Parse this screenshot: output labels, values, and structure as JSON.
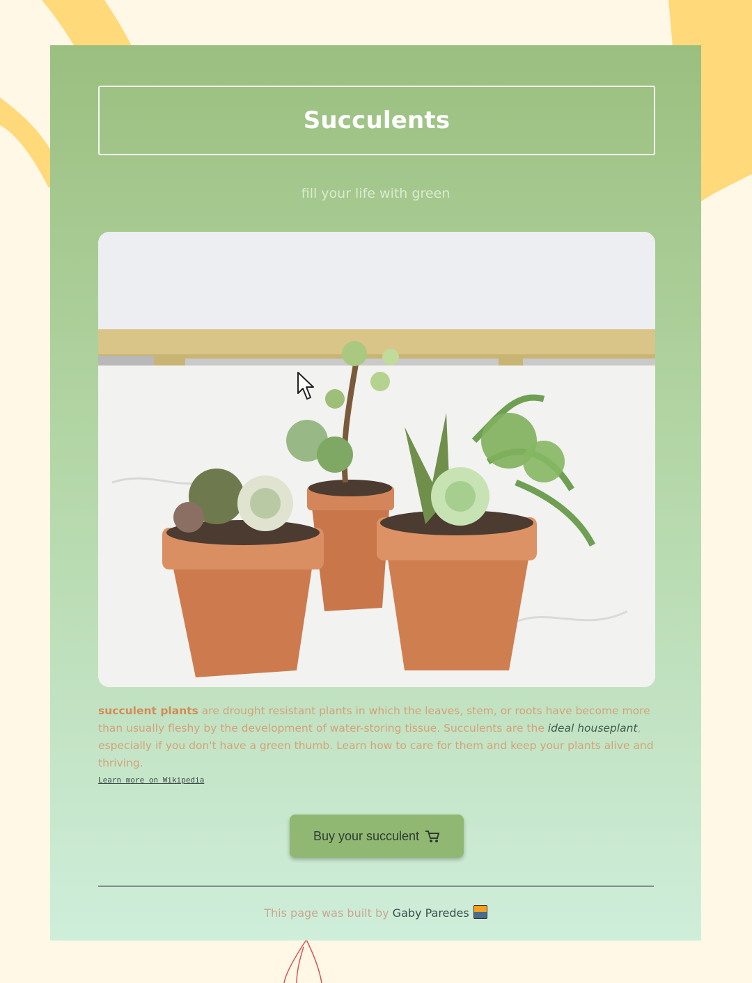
{
  "page": {
    "title": "Succulents",
    "subtitle": "fill your life with green"
  },
  "description": {
    "strong": "succulent plants",
    "text1": " are drought resistant plants in which the leaves, stem, or roots have become more than usually fleshy by the development of water-storing tissue. Succulents are the ",
    "emphasis": "ideal houseplant",
    "text2": ", especially if you don't have a green thumb. Learn how to care for them and keep your plants alive and thriving."
  },
  "link": {
    "label": "Learn more on Wikipedia"
  },
  "buy_button": {
    "label": "Buy your succulent",
    "icon": "cart-icon"
  },
  "footer": {
    "prefix": "This page was built by ",
    "author": "Gaby Paredes",
    "avatar_icon": "avatar-icon"
  },
  "colors": {
    "background": "#fff8e6",
    "deco_yellow": "#ffd97a",
    "card_top": "#9bbf7f",
    "card_bottom": "#cfeedb",
    "button": "#91b873",
    "text_accent": "#d48b58"
  }
}
